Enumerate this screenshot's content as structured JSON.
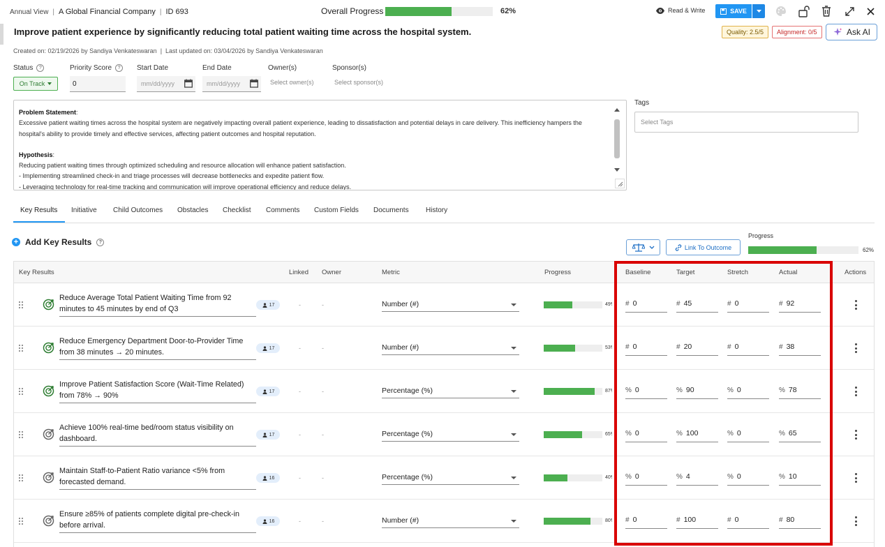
{
  "header": {
    "view": "Annual View",
    "company": "A Global Financial Company",
    "id_label": "ID 693",
    "overall_progress_label": "Overall Progress",
    "overall_progress_value": 0.62,
    "overall_progress_text": "62%",
    "mode_label": "Read & Write",
    "save_label": "SAVE",
    "icons": [
      "eye-icon",
      "save-icon",
      "palette-icon",
      "unlock-icon",
      "trash-icon",
      "expand-icon",
      "close-icon"
    ]
  },
  "title": "Improve patient experience by significantly reducing total patient waiting time across the hospital system.",
  "badges": {
    "quality": "Quality: 2.5/5",
    "alignment": "Alignment: 0/5"
  },
  "ask_ai_label": "Ask AI",
  "meta": {
    "created_label": "Created on:",
    "created_date": "02/19/2026",
    "created_by": "by Sandiya Venkateswaran",
    "updated_label": "Last updated on:",
    "updated_date": "03/04/2026",
    "updated_by": "by Sandiya Venkateswaran"
  },
  "fields": {
    "status_label": "Status",
    "status_value": "On Track",
    "priority_label": "Priority Score",
    "priority_value": "0",
    "start_label": "Start Date",
    "start_placeholder": "mm/dd/yyyy",
    "end_label": "End Date",
    "end_placeholder": "mm/dd/yyyy",
    "owner_label": "Owner(s)",
    "owner_placeholder": "Select owner(s)",
    "sponsor_label": "Sponsor(s)",
    "sponsor_placeholder": "Select sponsor(s)"
  },
  "description": {
    "problem_heading": "Problem Statement",
    "problem_text": "Excessive patient waiting times across the hospital system are negatively impacting overall patient experience, leading to dissatisfaction and potential delays in care delivery. This inefficiency hampers the hospital's ability to provide timely and effective services, affecting patient outcomes and hospital reputation.",
    "hypothesis_heading": "Hypothesis",
    "hypothesis_lines": [
      "Reducing patient waiting times through optimized scheduling and resource allocation will enhance patient satisfaction.",
      "- Implementing streamlined check-in and triage processes will decrease bottlenecks and expedite patient flow.",
      "- Leveraging technology for real-time tracking and communication will improve operational efficiency and reduce delays."
    ]
  },
  "tags": {
    "label": "Tags",
    "placeholder": "Select Tags"
  },
  "tabs": [
    "Key Results",
    "Initiative",
    "Child Outcomes",
    "Obstacles",
    "Checklist",
    "Comments",
    "Custom Fields",
    "Documents",
    "History"
  ],
  "key_results_section": {
    "add_label": "Add Key Results",
    "link_label": "Link To Outcome",
    "progress_label": "Progress",
    "progress_value": 0.62,
    "progress_text": "62%"
  },
  "table": {
    "headers": {
      "kr": "Key Results",
      "linked": "Linked",
      "owner": "Owner",
      "metric": "Metric",
      "progress": "Progress",
      "baseline": "Baseline",
      "target": "Target",
      "stretch": "Stretch",
      "actual": "Actual",
      "actions": "Actions"
    },
    "rows": [
      {
        "title": "Reduce Average Total Patient Waiting Time from 92 minutes to  45 minutes by end of Q3",
        "count": "17",
        "linked": "-",
        "owner": "-",
        "metric": "Number (#)",
        "progress": 0.49,
        "progress_text": "49%",
        "sym": "#",
        "baseline": "0",
        "target": "45",
        "stretch": "0",
        "actual": "92",
        "status": "green"
      },
      {
        "title": "Reduce Emergency Department Door-to-Provider Time from 38 minutes → 20 minutes.",
        "count": "17",
        "linked": "-",
        "owner": "-",
        "metric": "Number (#)",
        "progress": 0.53,
        "progress_text": "53%",
        "sym": "#",
        "baseline": "0",
        "target": "20",
        "stretch": "0",
        "actual": "38",
        "status": "green"
      },
      {
        "title": "Improve Patient Satisfaction Score (Wait-Time Related) from 78% → 90%",
        "count": "17",
        "linked": "-",
        "owner": "-",
        "metric": "Percentage (%)",
        "progress": 0.87,
        "progress_text": "87%",
        "sym": "%",
        "baseline": "0",
        "target": "90",
        "stretch": "0",
        "actual": "78",
        "status": "green"
      },
      {
        "title": "Achieve 100% real-time bed/room status visibility on dashboard.",
        "count": "17",
        "linked": "-",
        "owner": "-",
        "metric": "Percentage (%)",
        "progress": 0.65,
        "progress_text": "65%",
        "sym": "%",
        "baseline": "0",
        "target": "100",
        "stretch": "0",
        "actual": "65",
        "status": "grey"
      },
      {
        "title": "Maintain Staff-to-Patient Ratio variance <5% from forecasted demand.",
        "count": "16",
        "linked": "-",
        "owner": "-",
        "metric": "Percentage (%)",
        "progress": 0.4,
        "progress_text": "40%",
        "sym": "%",
        "baseline": "0",
        "target": "4",
        "stretch": "0",
        "actual": "10",
        "status": "grey"
      },
      {
        "title": "Ensure ≥85% of patients complete digital pre-check-in before arrival.",
        "count": "16",
        "linked": "-",
        "owner": "-",
        "metric": "Number (#)",
        "progress": 0.8,
        "progress_text": "80%",
        "sym": "#",
        "baseline": "0",
        "target": "100",
        "stretch": "0",
        "actual": "80",
        "status": "grey"
      }
    ]
  },
  "colors": {
    "accent": "#2196f3",
    "progress": "#4caf50",
    "highlight": "#d90000"
  }
}
